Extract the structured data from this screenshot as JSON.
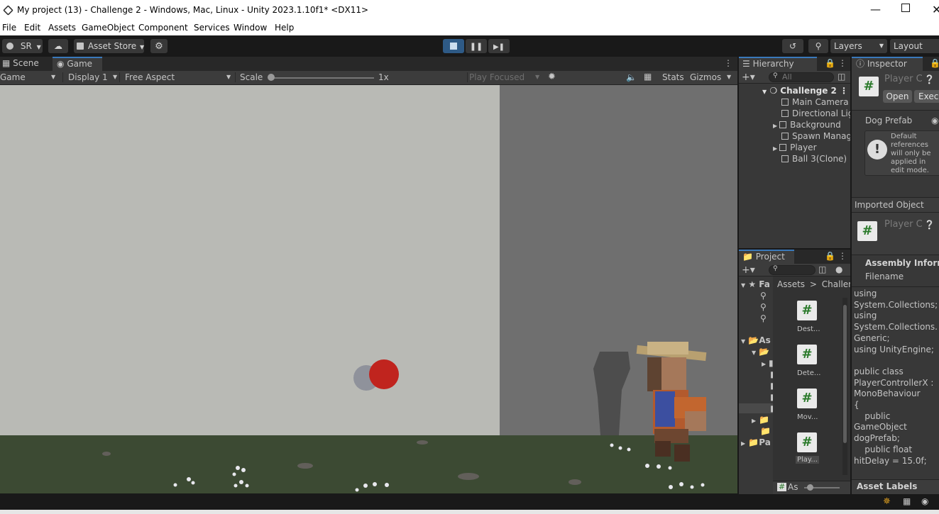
{
  "title": "My project (13) - Challenge 2 - Windows, Mac, Linux - Unity 2023.1.10f1* <DX11>",
  "menu": [
    "File",
    "Edit",
    "Assets",
    "GameObject",
    "Component",
    "Services",
    "Window",
    "Help"
  ],
  "toolbar": {
    "account": "SR",
    "asset_store": "Asset Store",
    "layers": "Layers",
    "layout": "Layout"
  },
  "scene_tabs": {
    "scene": "Scene",
    "game": "Game"
  },
  "game_bar": {
    "mode": "Game",
    "display": "Display 1",
    "aspect": "Free Aspect",
    "scale_label": "Scale",
    "scale_value": "1x",
    "play_focused": "Play Focused",
    "stats": "Stats",
    "gizmos": "Gizmos"
  },
  "hierarchy": {
    "tab": "Hierarchy",
    "search_placeholder": "All",
    "root": "Challenge 2",
    "items": [
      "Main Camera",
      "Directional Light",
      "Background",
      "Spawn Manager",
      "Player",
      "Ball 3(Clone)"
    ]
  },
  "project": {
    "tab": "Project",
    "breadcrumb_root": "Assets",
    "breadcrumb_sep": ">",
    "breadcrumb_child": "Challenge",
    "tree": [
      "Fa",
      "As",
      "Pa"
    ],
    "files": [
      "Dest...",
      "Dete...",
      "Mov...",
      "Play..."
    ],
    "footer": "As"
  },
  "inspector": {
    "tab": "Inspector",
    "object_name": "Player C",
    "open_btn": "Open",
    "exec_btn": "Exec",
    "dog_prefab_label": "Dog Prefab",
    "warning": "Default references will only be applied in edit mode.",
    "imported_header": "Imported Object",
    "imported_name": "Player C",
    "assembly_header": "Assembly Information",
    "filename_label": "Filename",
    "code": "using\nSystem.Collections;\nusing\nSystem.Collections.\nGeneric;\nusing UnityEngine;\n\npublic class\nPlayerControllerX :\nMonoBehaviour\n{\n    public\nGameObject\ndogPrefab;\n    public float\nhitDelay = 15.0f;",
    "asset_labels": "Asset Labels"
  },
  "colors": {
    "accent": "#3a79bb",
    "ball": "#c0241e",
    "wall": "#b9bab5",
    "shadow_wall": "#6f6f6f",
    "grass": "#3c4a33"
  }
}
